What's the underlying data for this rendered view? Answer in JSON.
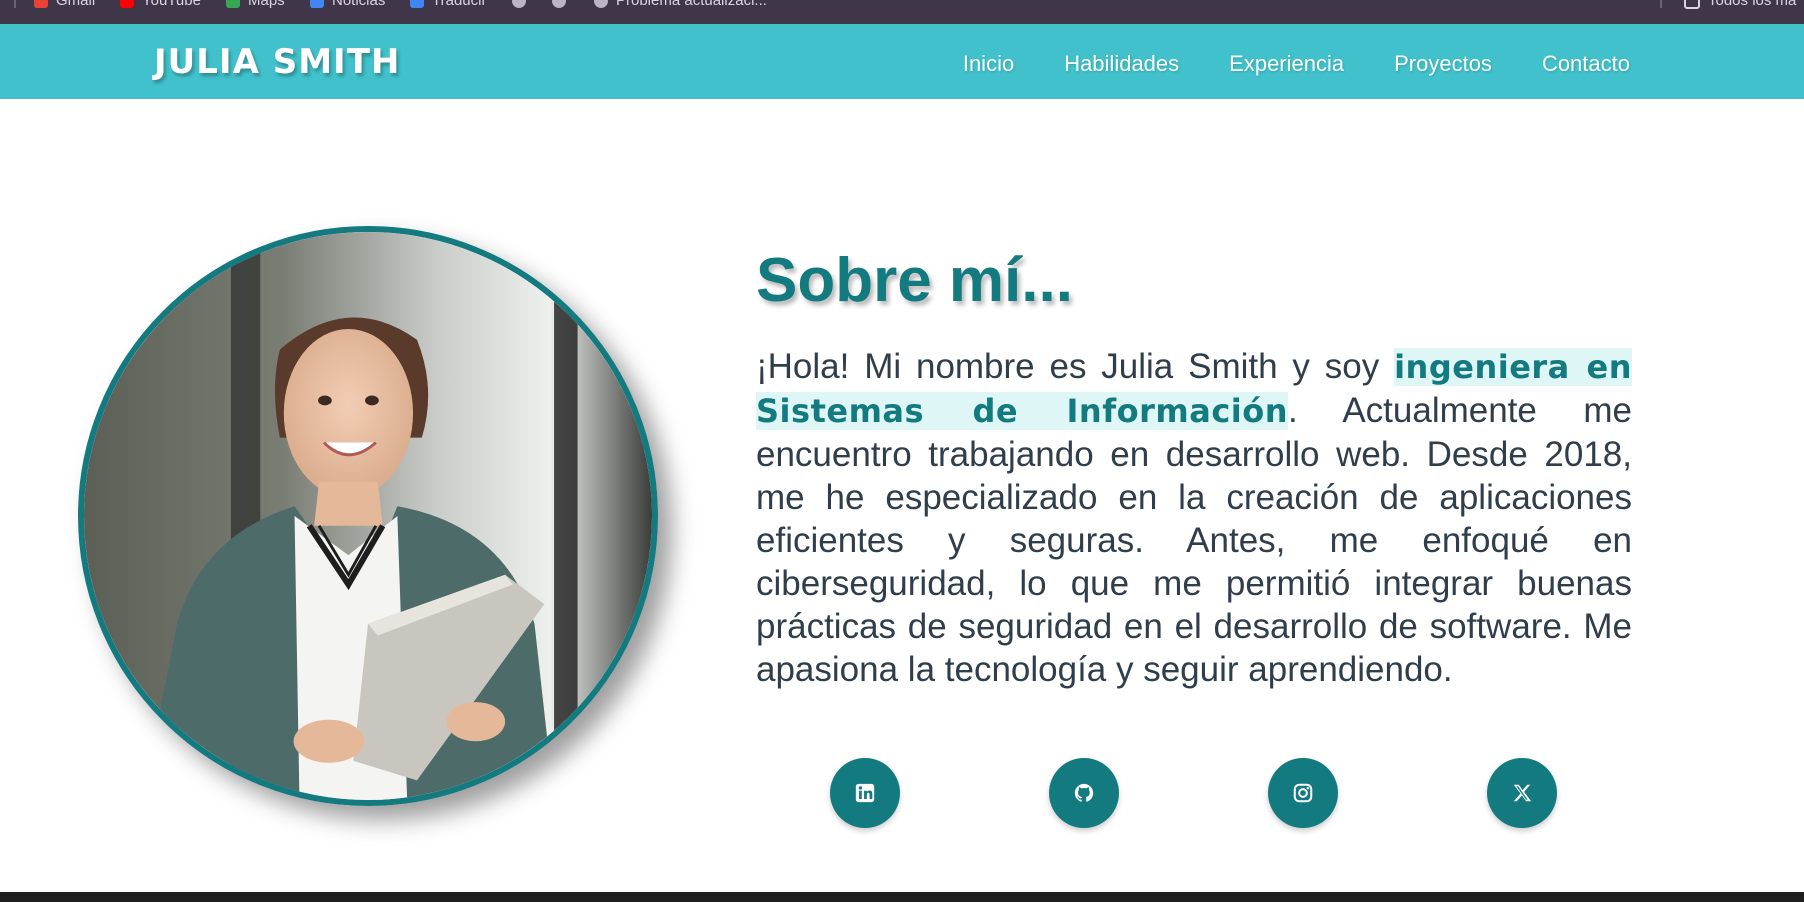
{
  "browser": {
    "bookmarks": [
      {
        "label": "Gmail",
        "icon": "gmail-icon"
      },
      {
        "label": "YouTube",
        "icon": "youtube-icon"
      },
      {
        "label": "Maps",
        "icon": "maps-icon"
      },
      {
        "label": "Noticias",
        "icon": "news-icon"
      },
      {
        "label": "Traducir",
        "icon": "translate-icon"
      },
      {
        "label": "",
        "icon": "bookmark-icon"
      },
      {
        "label": "",
        "icon": "bookmark-icon"
      },
      {
        "label": "Problema actualizaci...",
        "icon": "bookmark-icon"
      }
    ],
    "all_bookmarks_label": "Todos los ma"
  },
  "header": {
    "brand": "JULIA SMITH",
    "nav": [
      "Inicio",
      "Habilidades",
      "Experiencia",
      "Proyectos",
      "Contacto"
    ]
  },
  "about": {
    "title": "Sobre mí...",
    "intro": "¡Hola! Mi nombre es Julia Smith y soy ",
    "highlight": "ingeniera en Sistemas de Información",
    "rest": ". Actualmente me encuentro trabajando en desarrollo web. Desde 2018, me he especializado en la creación de aplicaciones eficientes y seguras. Antes, me enfoqué en ciberseguridad, lo que me permitió integrar buenas prácticas de seguridad en el desarrollo de software. Me apasiona la tecnología y seguir aprendiendo."
  },
  "social": [
    {
      "icon": "linkedin-icon"
    },
    {
      "icon": "github-icon"
    },
    {
      "icon": "instagram-icon"
    },
    {
      "icon": "x-icon"
    }
  ],
  "colors": {
    "header": "#40c1cb",
    "accent": "#137a80",
    "text": "#2f3e4a",
    "highlight_bg": "#dff6f6"
  }
}
